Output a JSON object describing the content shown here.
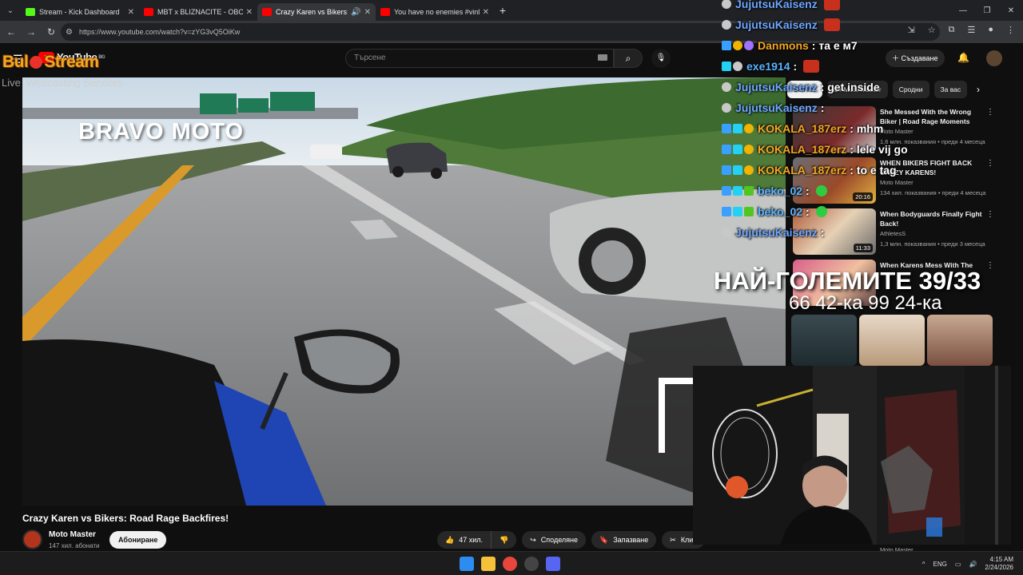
{
  "browser": {
    "tabs": [
      {
        "title": "Stream - Kick Dashboard",
        "favicon": "kick-icon",
        "active": false
      },
      {
        "title": "MBT x BLIZNACITE - OBOROT",
        "favicon": "youtube-icon",
        "active": false
      },
      {
        "title": "Crazy Karen vs Bikers: Road",
        "favicon": "youtube-icon",
        "active": true,
        "audio": true
      },
      {
        "title": "You have no enemies #vinland",
        "favicon": "youtube-icon",
        "active": false
      }
    ],
    "url": "https://www.youtube.com/watch?v=zYG3vQ5OiKw"
  },
  "youtube": {
    "logo_text": "YouTube",
    "region": "BG",
    "search_placeholder": "Търсене",
    "create_label": "Създаване"
  },
  "overlay": {
    "logo_left": "Bul",
    "logo_right": "Stream",
    "live_text": "Live",
    "webcasting": "Webcasting Services",
    "score_line1": "НАЙ-ГОЛЕМИТЕ 39/33",
    "score_line2": "66 42-ка 99 24-ка"
  },
  "video": {
    "watermark": "BRAVO MOTO",
    "title": "Crazy Karen vs Bikers: Road Rage Backfires!",
    "channel": "Moto Master",
    "subscribers": "147 хил. абонати",
    "subscribe_label": "Абониране",
    "likes": "47 хил.",
    "share_label": "Споделяне",
    "save_label": "Запазване",
    "clip_label": "Клип"
  },
  "chips": [
    "Всички",
    "От Moto Master",
    "Сродни",
    "За вас"
  ],
  "recommendations": [
    {
      "title": "She Messed With the Wrong Biker | Road Rage Moments",
      "channel": "Moto Master",
      "meta": "1,6 млн. показвания • преди 4 месеца",
      "duration": ""
    },
    {
      "title": "WHEN BIKERS FIGHT BACK CRAZY KARENS!",
      "channel": "Moto Master",
      "meta": "134 хил. показвания • преди 4 месеца",
      "duration": "20:16"
    },
    {
      "title": "When Bodyguards Finally Fight Back!",
      "channel": "AthletesS",
      "meta": "1,3 млн. показвания • преди 3 месеца",
      "duration": "11:33"
    },
    {
      "title": "When Karens Mess With The",
      "channel": "",
      "meta": "",
      "duration": ""
    }
  ],
  "chat": [
    {
      "user": "JujutsuKaisenz",
      "color": "#6ea8ff",
      "badges": [
        "gray"
      ],
      "message": "",
      "emote": "red"
    },
    {
      "user": "JujutsuKaisenz",
      "color": "#6ea8ff",
      "badges": [
        "gray"
      ],
      "message": "",
      "emote": "red"
    },
    {
      "user": "Danmons",
      "color": "#f5a623",
      "badges": [
        "blue",
        "gold",
        "purple"
      ],
      "message": ": та е м7",
      "emote": ""
    },
    {
      "user": "exe1914",
      "color": "#5ab4ff",
      "badges": [
        "cyan",
        "gray"
      ],
      "message": ":",
      "emote": "red"
    },
    {
      "user": "JujutsuKaisenz",
      "color": "#6ea8ff",
      "badges": [
        "gray"
      ],
      "message": ": get inside",
      "emote": ""
    },
    {
      "user": "JujutsuKaisenz",
      "color": "#6ea8ff",
      "badges": [
        "gray"
      ],
      "message": ":",
      "emote": ""
    },
    {
      "user": "KOKALA_187erz",
      "color": "#f5a623",
      "badges": [
        "blue",
        "cyan",
        "gold"
      ],
      "message": ": mhm",
      "emote": ""
    },
    {
      "user": "KOKALA_187erz",
      "color": "#f5a623",
      "badges": [
        "blue",
        "cyan",
        "gold"
      ],
      "message": ": lele vij go",
      "emote": ""
    },
    {
      "user": "KOKALA_187erz",
      "color": "#f5a623",
      "badges": [
        "blue",
        "cyan",
        "gold"
      ],
      "message": ": to e tag",
      "emote": ""
    },
    {
      "user": "beko_02",
      "color": "#5ab4ff",
      "badges": [
        "blue",
        "cyan",
        "green"
      ],
      "message": ":",
      "emote": "green"
    },
    {
      "user": "beko_02",
      "color": "#5ab4ff",
      "badges": [
        "blue",
        "cyan",
        "green"
      ],
      "message": ":",
      "emote": "green"
    },
    {
      "user": "JujutsuKaisenz",
      "color": "#6ea8ff",
      "badges": [
        "gray"
      ],
      "message": ":",
      "emote": ""
    }
  ],
  "webcam_channel": "Moto Master",
  "taskbar": {
    "lang": "ENG",
    "time": "4:15 AM",
    "date": "2/24/2026"
  }
}
